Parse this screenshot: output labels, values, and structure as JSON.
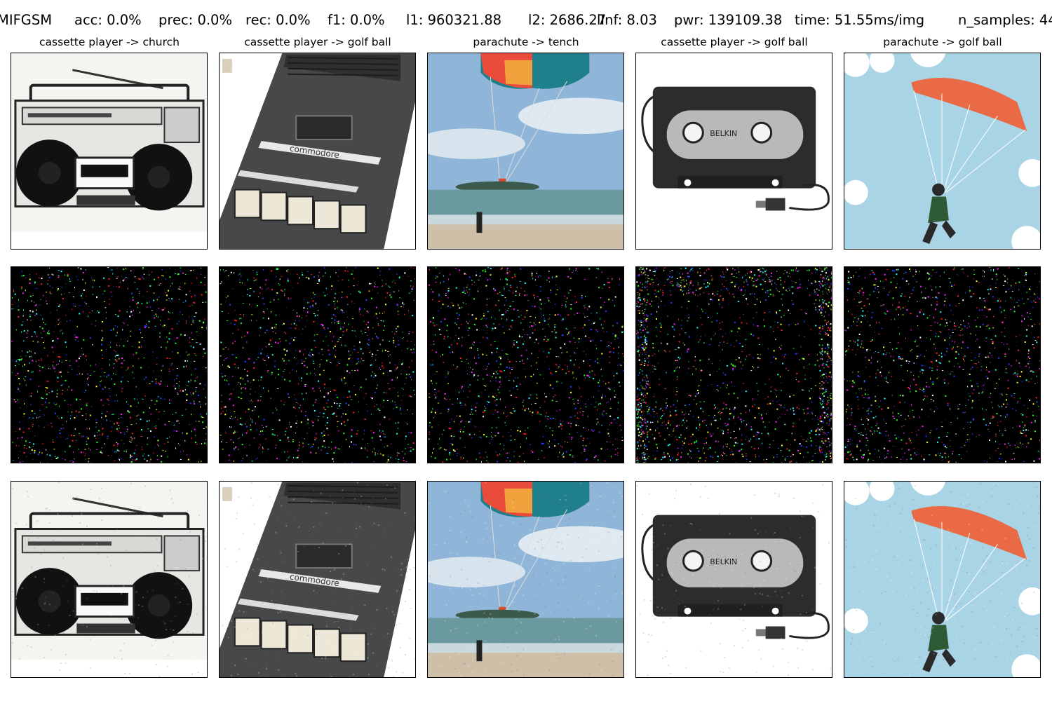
{
  "header": {
    "attack": "MIFGSM",
    "acc": "acc: 0.0%",
    "prec": "prec: 0.0%",
    "rec": "rec: 0.0%",
    "f1": "f1: 0.0%",
    "l1": "l1: 960321.88",
    "l2": "l2: 2686.27",
    "linf": "lInf: 8.03",
    "pwr": "pwr: 139109.38",
    "time": "time: 51.55ms/img",
    "n_samples": "n_samples: 44"
  },
  "columns": [
    {
      "title": "cassette player -> church",
      "image": "boombox"
    },
    {
      "title": "cassette player -> golf ball",
      "image": "commodore-cassette-player"
    },
    {
      "title": "parachute -> tench",
      "image": "parasail-beach"
    },
    {
      "title": "cassette player -> golf ball",
      "image": "belkin-cassette-adapter"
    },
    {
      "title": "parachute -> golf ball",
      "image": "parachute-illustration"
    }
  ],
  "rows": [
    "original",
    "perturbation",
    "adversarial"
  ],
  "colors": {
    "sky": "#87b3d9",
    "paraglider_sky": "#a9d4e6",
    "canopy_orange": "#ea6a45",
    "cassette_body": "#2c2c2e",
    "cassette_label": "#b9b9b9",
    "sand": "#cdbfa8",
    "sea": "#6a9aa0"
  }
}
